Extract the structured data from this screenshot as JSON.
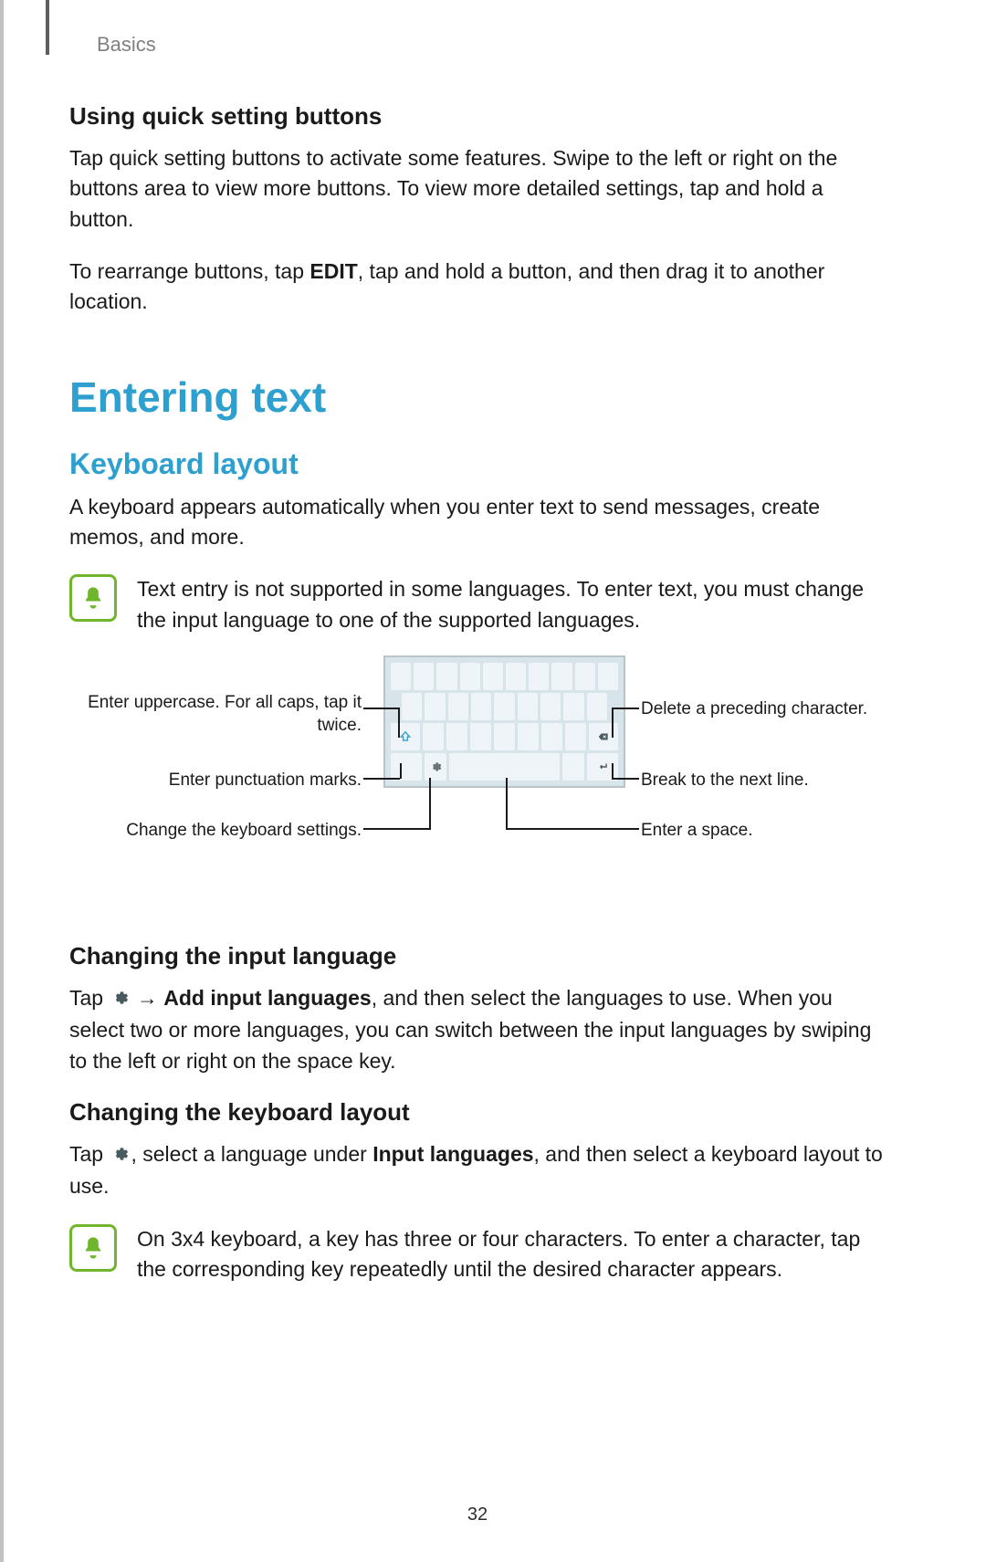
{
  "breadcrumb": "Basics",
  "using_quick": {
    "heading": "Using quick setting buttons",
    "p1": "Tap quick setting buttons to activate some features. Swipe to the left or right on the buttons area to view more buttons. To view more detailed settings, tap and hold a button.",
    "p2_pre": "To rearrange buttons, tap ",
    "p2_bold": "EDIT",
    "p2_post": ", tap and hold a button, and then drag it to another location."
  },
  "title": "Entering text",
  "keyboard_layout": {
    "heading": "Keyboard layout",
    "intro": "A keyboard appears automatically when you enter text to send messages, create memos, and more.",
    "note": "Text entry is not supported in some languages. To enter text, you must change the input language to one of the supported languages."
  },
  "callouts": {
    "uppercase": "Enter uppercase. For all caps, tap it twice.",
    "punctuation": "Enter punctuation marks.",
    "settings": "Change the keyboard settings.",
    "delete": "Delete a preceding character.",
    "nextline": "Break to the next line.",
    "space": "Enter a space."
  },
  "changing_input": {
    "heading": "Changing the input language",
    "p_pre": "Tap ",
    "p_arrow": " → ",
    "p_bold": "Add input languages",
    "p_post": ", and then select the languages to use. When you select two or more languages, you can switch between the input languages by swiping to the left or right on the space key."
  },
  "changing_layout": {
    "heading": "Changing the keyboard layout",
    "p_pre": "Tap ",
    "p_mid": ", select a language under ",
    "p_bold": "Input languages",
    "p_post": ", and then select a keyboard layout to use.",
    "note_pre": "On ",
    "note_bold": "3x4 keyboard",
    "note_post": ", a key has three or four characters. To enter a character, tap the corresponding key repeatedly until the desired character appears."
  },
  "page_number": "32"
}
